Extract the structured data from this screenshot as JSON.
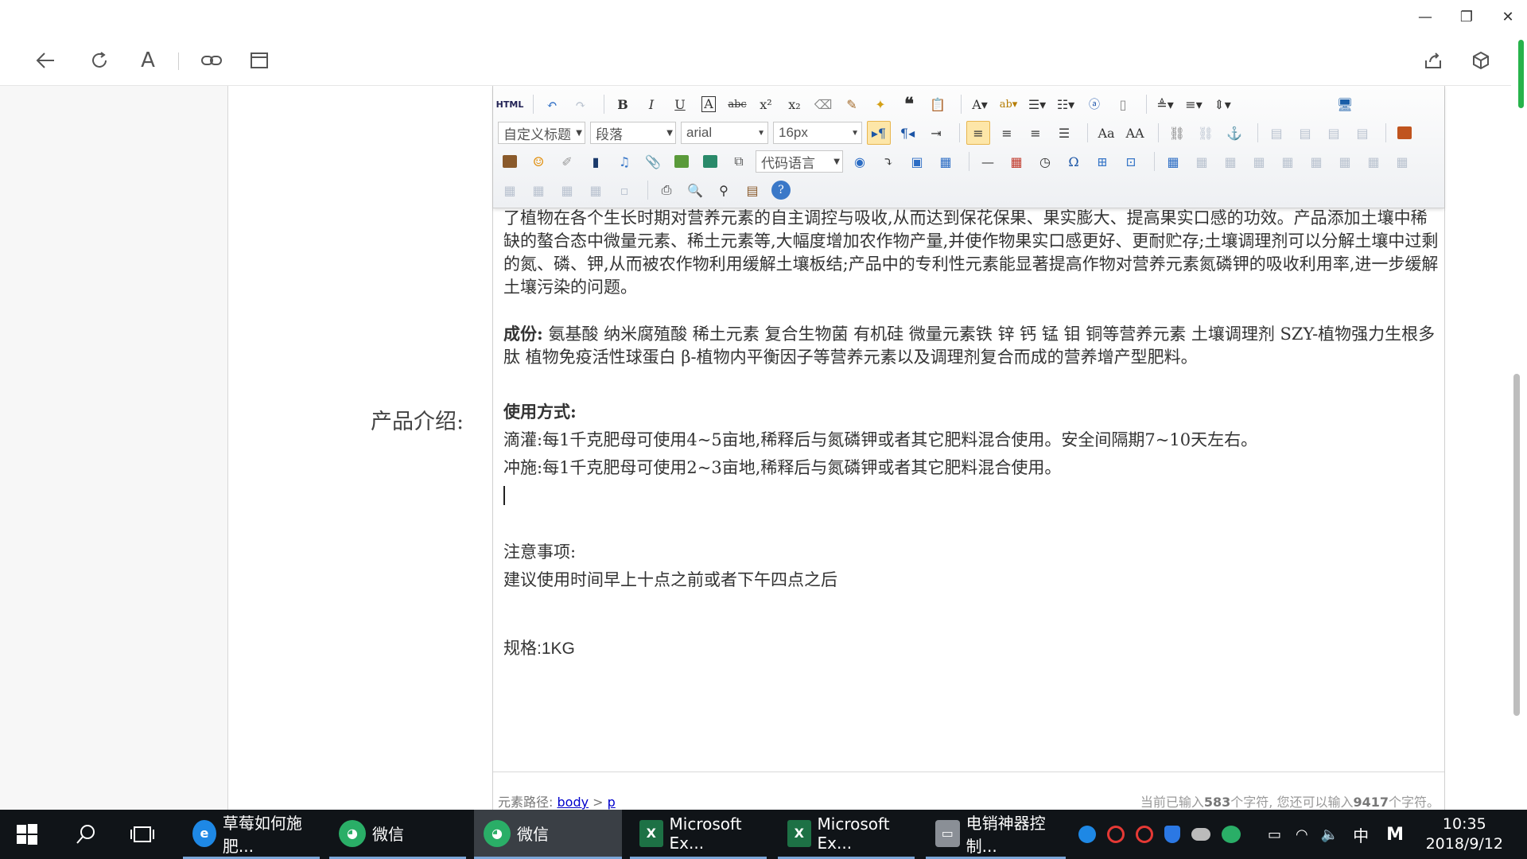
{
  "window": {
    "minimize_glyph": "—",
    "restore_glyph": "❐",
    "close_glyph": "✕"
  },
  "browser_toolbar": {
    "icons": [
      "back-arrow-icon",
      "refresh-icon",
      "font-icon",
      "link-icon",
      "window-icon",
      "share-icon",
      "cube-icon"
    ],
    "font_icon_glyph": "A"
  },
  "form": {
    "field_label": "产品介绍:"
  },
  "editor": {
    "toolbar": {
      "html_label": "HTML",
      "heading_combo": "自定义标题",
      "paragraph_combo": "段落",
      "font_combo": "arial",
      "size_combo": "16px",
      "code_lang_combo": "代码语言"
    },
    "content": {
      "intro": "了植物在各个生长时期对营养元素的自主调控与吸收,从而达到保花保果、果实膨大、提高果实口感的功效。产品添加土壤中稀缺的螯合态中微量元素、稀土元素等,大幅度增加农作物产量,并使作物果实口感更好、更耐贮存;土壤调理剂可以分解土壤中过剩的氮、磷、钾,从而被农作物利用缓解土壤板结;产品中的专利性元素能显著提高作物对营养元素氮磷钾的吸收利用率,进一步缓解土壤污染的问题。",
      "ingredients_label": "成份:",
      "ingredients_text": "  氨基酸 纳米腐殖酸  稀土元素 复合生物菌 有机硅   微量元素铁 锌 钙 锰 钼 铜等营养元素 土壤调理剂   SZY-植物强力生根多肽 植物免疫活性球蛋白   β-植物内平衡因子等营养元素以及调理剂复合而成的营养增产型肥料。",
      "usage_label": "使用方式:",
      "usage_drip": "滴灌:每1千克肥母可使用4~5亩地,稀释后与氮磷钾或者其它肥料混合使用。安全间隔期7~10天左右。",
      "usage_flush": "冲施:每1千克肥母可使用2~3亩地,稀释后与氮磷钾或者其它肥料混合使用。",
      "notes_label": "注意事项:",
      "notes_text": "建议使用时间早上十点之前或者下午四点之后",
      "spec": "规格:1KG"
    },
    "status": {
      "path_label": "元素路径:",
      "path_body": "body",
      "path_sep": ">",
      "path_p": "p",
      "count_prefix": "当前已输入",
      "count_current": "583",
      "count_mid": "个字符, 您还可以输入",
      "count_remaining": "9417",
      "count_suffix": "个字符。"
    }
  },
  "taskbar": {
    "tasks": [
      {
        "label": "草莓如何施肥...",
        "icon": "ie-icon"
      },
      {
        "label": "微信",
        "icon": "wechat-icon"
      },
      {
        "label": "微信",
        "icon": "wechat-icon"
      },
      {
        "label": "Microsoft Ex...",
        "icon": "excel-icon"
      },
      {
        "label": "Microsoft Ex...",
        "icon": "excel-icon"
      },
      {
        "label": "电销神器控制...",
        "icon": "app-icon"
      }
    ],
    "ime": "中",
    "time": "10:35",
    "date": "2018/9/12"
  },
  "colors": {
    "accent_green": "#27b34b",
    "editor_link": "#0000cc",
    "taskbar_bg": "#101418"
  }
}
